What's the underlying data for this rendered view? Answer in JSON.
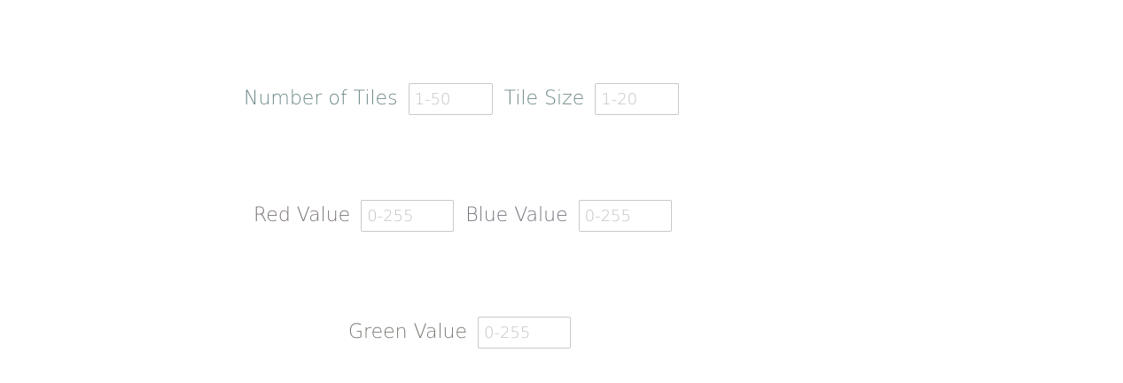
{
  "form": {
    "row1": {
      "tiles_label": "Number of Tiles",
      "tiles_placeholder": "1-50",
      "size_label": "Tile Size",
      "size_placeholder": "1-20"
    },
    "row2": {
      "red_label": "Red Value",
      "red_placeholder": "0-255",
      "blue_label": "Blue Value",
      "blue_placeholder": "0-255"
    },
    "row3": {
      "green_label": "Green Value",
      "green_placeholder": "0-255"
    }
  }
}
